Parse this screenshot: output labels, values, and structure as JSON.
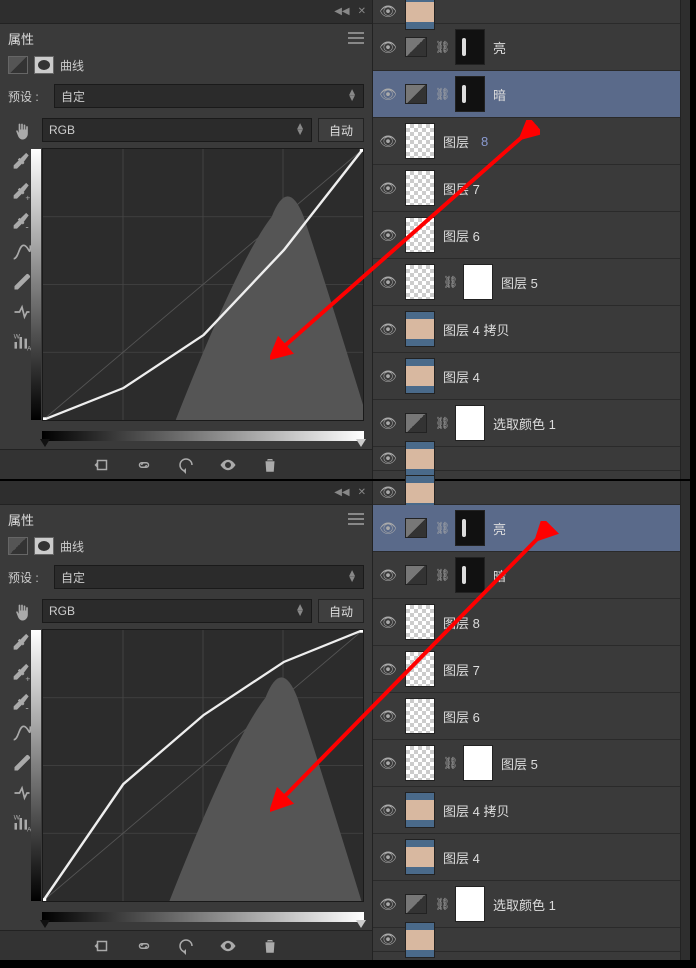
{
  "panels": [
    {
      "header_title": "属性",
      "adjust_label": "曲线",
      "preset_label": "预设 :",
      "preset_value": "自定",
      "channel_value": "RGB",
      "auto_label": "自动",
      "selected_layer": "dark",
      "chart_data": {
        "type": "line",
        "xlim": [
          0,
          255
        ],
        "ylim": [
          0,
          255
        ],
        "curve": [
          [
            0,
            0
          ],
          [
            64,
            30
          ],
          [
            128,
            80
          ],
          [
            192,
            160
          ],
          [
            255,
            255
          ]
        ],
        "histogram_peak_x": 195
      },
      "layers": [
        {
          "id": "top",
          "small": true,
          "eye": true,
          "thumb": "face",
          "name": ""
        },
        {
          "id": "bright",
          "eye": true,
          "adj": true,
          "mask": "black",
          "name": "亮"
        },
        {
          "id": "dark",
          "eye": true,
          "adj": true,
          "mask": "black",
          "name": "暗"
        },
        {
          "id": "l8",
          "eye": true,
          "thumb": "transp",
          "name": "图层",
          "sub": "8"
        },
        {
          "id": "l7",
          "eye": true,
          "thumb": "transp",
          "name": "图层 7"
        },
        {
          "id": "l6",
          "eye": true,
          "thumb": "transp",
          "name": "图层 6"
        },
        {
          "id": "l5",
          "eye": true,
          "thumb": "transp",
          "mask": "white",
          "name": "图层 5"
        },
        {
          "id": "l4c",
          "eye": true,
          "thumb": "face",
          "name": "图层 4 拷贝"
        },
        {
          "id": "l4",
          "eye": true,
          "thumb": "face",
          "name": "图层 4"
        },
        {
          "id": "sel",
          "eye": true,
          "adj": true,
          "mask": "white",
          "name": "选取颜色 1"
        },
        {
          "id": "bot",
          "small": true,
          "eye": true,
          "thumb": "face",
          "name": ""
        }
      ]
    },
    {
      "header_title": "属性",
      "adjust_label": "曲线",
      "preset_label": "预设 :",
      "preset_value": "自定",
      "channel_value": "RGB",
      "auto_label": "自动",
      "selected_layer": "bright",
      "chart_data": {
        "type": "line",
        "xlim": [
          0,
          255
        ],
        "ylim": [
          0,
          255
        ],
        "curve": [
          [
            0,
            0
          ],
          [
            64,
            110
          ],
          [
            128,
            175
          ],
          [
            192,
            225
          ],
          [
            255,
            255
          ]
        ],
        "histogram_peak_x": 190
      },
      "layers": [
        {
          "id": "top",
          "small": true,
          "eye": true,
          "thumb": "face",
          "name": ""
        },
        {
          "id": "bright",
          "eye": true,
          "adj": true,
          "mask": "black",
          "name": "亮"
        },
        {
          "id": "dark",
          "eye": true,
          "adj": true,
          "mask": "black",
          "name": "暗"
        },
        {
          "id": "l8",
          "eye": true,
          "thumb": "transp",
          "name": "图层 8"
        },
        {
          "id": "l7",
          "eye": true,
          "thumb": "transp",
          "name": "图层 7"
        },
        {
          "id": "l6",
          "eye": true,
          "thumb": "transp",
          "name": "图层 6"
        },
        {
          "id": "l5",
          "eye": true,
          "thumb": "transp",
          "mask": "white",
          "name": "图层 5"
        },
        {
          "id": "l4c",
          "eye": true,
          "thumb": "face",
          "name": "图层 4 拷贝"
        },
        {
          "id": "l4",
          "eye": true,
          "thumb": "face",
          "name": "图层 4"
        },
        {
          "id": "sel",
          "eye": true,
          "adj": true,
          "mask": "white",
          "name": "选取颜色 1"
        },
        {
          "id": "bot",
          "small": true,
          "eye": true,
          "thumb": "face",
          "name": ""
        }
      ]
    }
  ]
}
